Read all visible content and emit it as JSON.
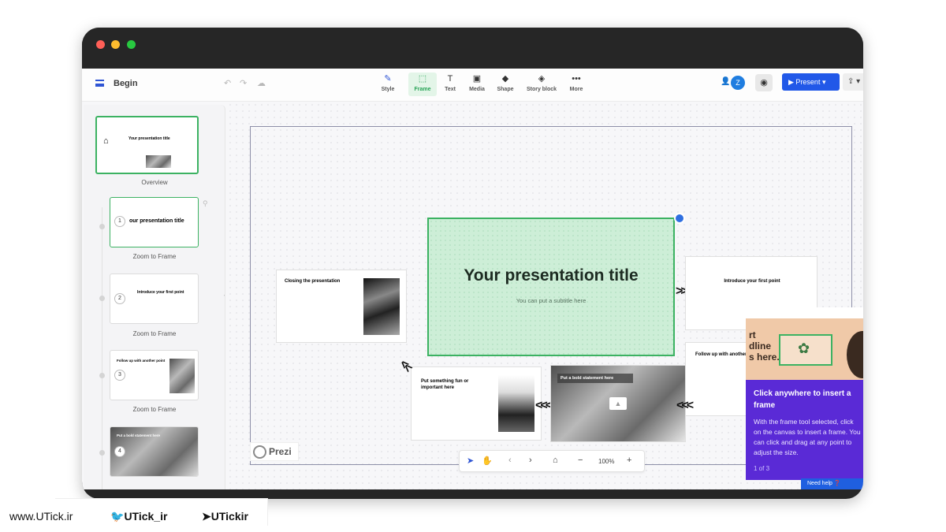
{
  "window": {
    "traffic_lights": [
      "#ff5f57",
      "#febc2e",
      "#28c840"
    ]
  },
  "header": {
    "document_title": "Begin",
    "undo_icon": "undo-icon",
    "redo_icon": "redo-icon",
    "cloud_icon": "cloud-sync-icon",
    "tools": [
      {
        "icon": "✎",
        "label": "Style"
      },
      {
        "icon": "⬚",
        "label": "Frame"
      },
      {
        "icon": "T",
        "label": "Text"
      },
      {
        "icon": "▣",
        "label": "Media"
      },
      {
        "icon": "◆",
        "label": "Shape"
      },
      {
        "icon": "◈",
        "label": "Story block"
      },
      {
        "icon": "•••",
        "label": "More"
      }
    ],
    "avatar_letter": "Z",
    "present_label": "Present ▾",
    "colors": {
      "accent": "#2158e8",
      "frame_green": "#3cb262",
      "tooltip": "#5a2ad6"
    }
  },
  "sidebar": {
    "overview_label": "Overview",
    "overview_title": "Your presentation title",
    "frames": [
      {
        "number": "1",
        "title": "our presentation title",
        "caption": "Zoom to Frame"
      },
      {
        "number": "2",
        "title": "Introduce your first point",
        "caption": "Zoom to Frame"
      },
      {
        "number": "3",
        "title": "Follow up with another point",
        "caption": "Zoom to Frame"
      },
      {
        "number": "4",
        "title": "Put a bold statement here",
        "caption": "Zoom to Frame"
      }
    ]
  },
  "canvas": {
    "main_title": "Your presentation title",
    "main_subtitle": "You can put a subtitle here",
    "closing_title": "Closing the presentation",
    "first_point_title": "Introduce your first point",
    "follow_up_title": "Follow up with another",
    "fun_title": "Put something fun or important here",
    "bold_title": "Put a bold statement here",
    "logo_text": "Prezi"
  },
  "tooltip": {
    "title": "Click anywhere to insert a frame",
    "body": "With the frame tool selected, click on the canvas to insert a frame. You can click and drag at any point to adjust the size.",
    "pager": "1 of 3",
    "help_label": "Need help"
  },
  "zoombar": {
    "zoom_level": "100%"
  },
  "footer": {
    "website": "www.UTick.ir",
    "twitter": "UTick_ir",
    "telegram": "UTickir"
  }
}
